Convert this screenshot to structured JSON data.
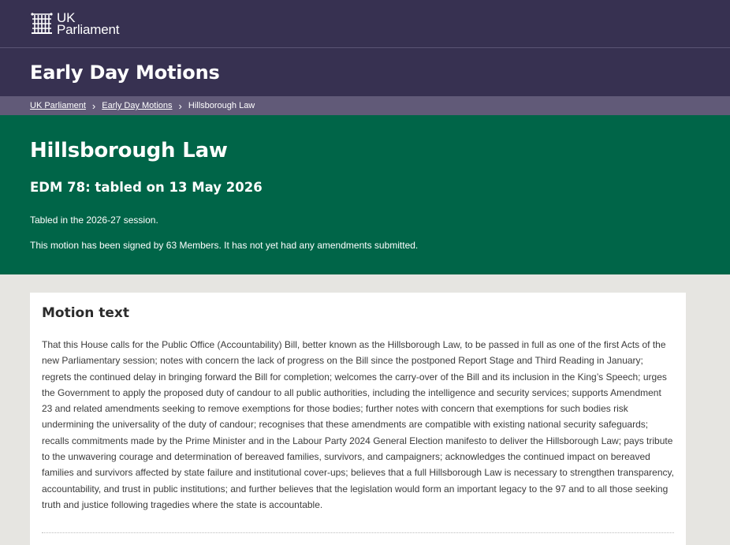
{
  "brand": {
    "line1": "UK",
    "line2": "Parliament"
  },
  "section": {
    "title": "Early Day Motions"
  },
  "breadcrumb": {
    "items": [
      "UK Parliament",
      "Early Day Motions",
      "Hillsborough Law"
    ]
  },
  "motion": {
    "title": "Hillsborough Law",
    "subtitle": "EDM 78: tabled on 13 May 2026",
    "session": "Tabled in the 2026-27 session.",
    "signatures": "This motion has been signed by 63 Members. It has not yet had any amendments submitted."
  },
  "motion_text": {
    "heading": "Motion text",
    "body": "That this House calls for the Public Office (Accountability) Bill, better known as the Hillsborough Law, to be passed in full as one of the first Acts of the new Parliamentary session; notes with concern the lack of progress on the Bill since the postponed Report Stage and Third Reading in January; regrets the continued delay in bringing forward the Bill for completion; welcomes the carry-over of the Bill and its inclusion in the King’s Speech; urges the Government to apply the proposed duty of candour to all public authorities, including the intelligence and security services; supports Amendment 23 and related amendments seeking to remove exemptions for those bodies; further notes with concern that exemptions for such bodies risk undermining the universality of the duty of candour; recognises that these amendments are compatible with existing national security safeguards; recalls commitments made by the Prime Minister and in the Labour Party 2024 General Election manifesto to deliver the Hillsborough Law; pays tribute to the unwavering courage and determination of bereaved families, survivors, and campaigners; acknowledges the continued impact on bereaved families and survivors affected by state failure and institutional cover-ups; believes that a full Hillsborough Law is necessary to strengthen transparency, accountability, and trust in public institutions; and further believes that the legislation would form an important legacy to the 97 and to all those seeking truth and justice following tragedies where the state is accountable."
  },
  "icons": {
    "logo": "portcullis-icon",
    "breadcrumb_separator": "chevron-right-icon"
  },
  "colors": {
    "header_bg": "#373151",
    "breadcrumb_bg": "#615a78",
    "hero_bg": "#006548",
    "page_bg": "#e6e5e1"
  }
}
